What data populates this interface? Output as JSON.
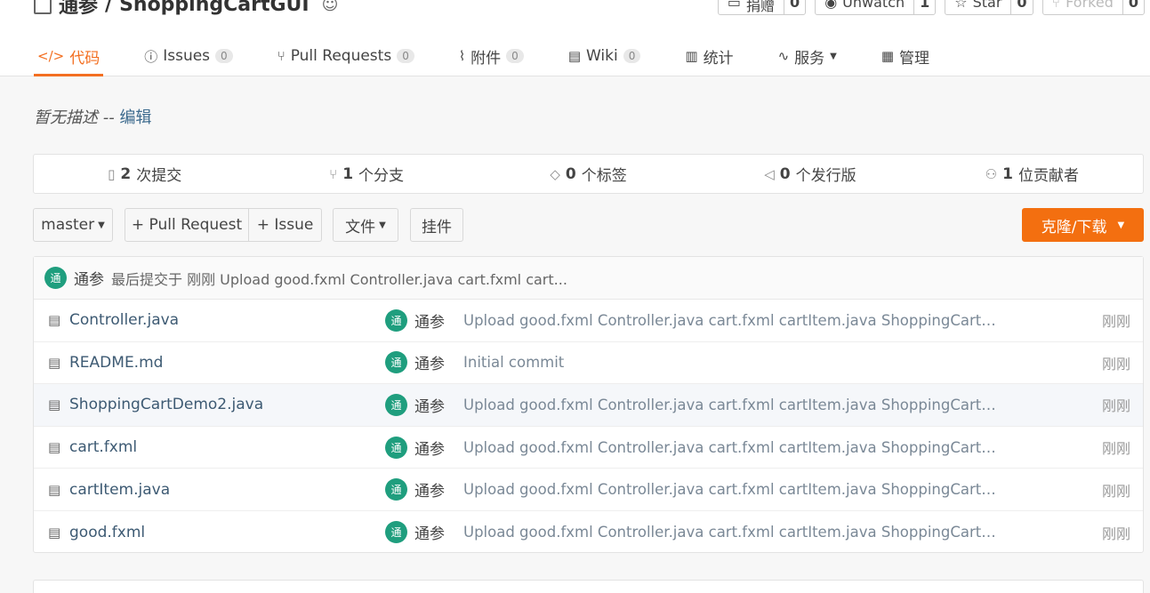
{
  "repo": {
    "owner": "通参",
    "separator": "/",
    "name": "ShoppingCartGUI"
  },
  "actions": [
    {
      "label": "捐赠",
      "count": "0",
      "icon": "donate-icon",
      "disabled": false
    },
    {
      "label": "Unwatch",
      "count": "1",
      "icon": "eye-icon",
      "disabled": false
    },
    {
      "label": "Star",
      "count": "0",
      "icon": "star-icon",
      "disabled": false
    },
    {
      "label": "Forked",
      "count": "0",
      "icon": "fork-icon",
      "disabled": true
    }
  ],
  "tabs": [
    {
      "label": "代码",
      "icon": "code-icon",
      "glyph": "</>",
      "count": null,
      "active": true
    },
    {
      "label": "Issues",
      "icon": "issue-icon",
      "glyph": "ⓘ",
      "count": "0",
      "active": false
    },
    {
      "label": "Pull Requests",
      "icon": "pull-request-icon",
      "glyph": "⑂",
      "count": "0",
      "active": false
    },
    {
      "label": "附件",
      "icon": "attachment-icon",
      "glyph": "⌇",
      "count": "0",
      "active": false
    },
    {
      "label": "Wiki",
      "icon": "wiki-icon",
      "glyph": "▤",
      "count": "0",
      "active": false
    },
    {
      "label": "统计",
      "icon": "stats-icon",
      "glyph": "▥",
      "count": null,
      "active": false
    },
    {
      "label": "服务",
      "icon": "service-icon",
      "glyph": "∿",
      "count": null,
      "active": false,
      "dropdown": true
    },
    {
      "label": "管理",
      "icon": "manage-icon",
      "glyph": "▦",
      "count": null,
      "active": false
    }
  ],
  "description": {
    "text": "暂无描述",
    "sep": " -- ",
    "edit_link": "编辑"
  },
  "stats": [
    {
      "num": "2",
      "label": " 次提交",
      "icon": "commit-icon",
      "glyph": "▯"
    },
    {
      "num": "1",
      "label": " 个分支",
      "icon": "branch-icon",
      "glyph": "⑂"
    },
    {
      "num": "0",
      "label": " 个标签",
      "icon": "tag-icon",
      "glyph": "◇"
    },
    {
      "num": "0",
      "label": " 个发行版",
      "icon": "release-icon",
      "glyph": "◁"
    },
    {
      "num": "1",
      "label": " 位贡献者",
      "icon": "contributors-icon",
      "glyph": "⚇"
    }
  ],
  "toolbar": {
    "branch": "master",
    "pull_request": "+ Pull Request",
    "issue": "+ Issue",
    "file": "文件",
    "widget": "挂件",
    "clone": "克隆/下载"
  },
  "commit_bar": {
    "avatar": "通",
    "author": "通参",
    "text": "最后提交于 刚刚 Upload good.fxml Controller.java cart.fxml cart..."
  },
  "files": [
    {
      "name": "Controller.java",
      "avatar": "通",
      "author": "通参",
      "message": "Upload good.fxml Controller.java cart.fxml cartItem.java ShoppingCartDe...",
      "time": "刚刚"
    },
    {
      "name": "README.md",
      "avatar": "通",
      "author": "通参",
      "message": "Initial commit",
      "time": "刚刚"
    },
    {
      "name": "ShoppingCartDemo2.java",
      "avatar": "通",
      "author": "通参",
      "message": "Upload good.fxml Controller.java cart.fxml cartItem.java ShoppingCartDe...",
      "time": "刚刚"
    },
    {
      "name": "cart.fxml",
      "avatar": "通",
      "author": "通参",
      "message": "Upload good.fxml Controller.java cart.fxml cartItem.java ShoppingCartDe...",
      "time": "刚刚"
    },
    {
      "name": "cartItem.java",
      "avatar": "通",
      "author": "通参",
      "message": "Upload good.fxml Controller.java cart.fxml cartItem.java ShoppingCartDe...",
      "time": "刚刚"
    },
    {
      "name": "good.fxml",
      "avatar": "通",
      "author": "通参",
      "message": "Upload good.fxml Controller.java cart.fxml cartItem.java ShoppingCartDe...",
      "time": "刚刚"
    }
  ],
  "colors": {
    "accent": "#f36f21",
    "avatar": "#1f9e7e"
  }
}
